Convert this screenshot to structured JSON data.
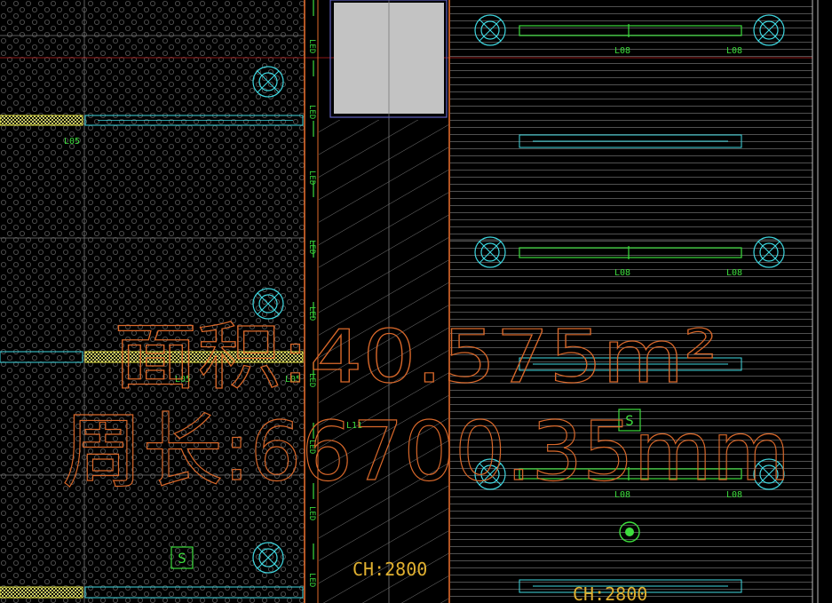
{
  "drawing": {
    "area_label": "面积:40.575m²",
    "perimeter_label": "周长:66700.35mm",
    "ceiling_height_label": "CH:2800",
    "ceiling_height_label_right": "CH:2800",
    "wall_strip_label": "LED",
    "light_tags": {
      "l05": "L05",
      "l08": "L08",
      "l11": "L11"
    },
    "switch_symbol": "S"
  },
  "colors": {
    "background": "#000000",
    "grid_line": "#7a7a7a",
    "wall": "#e06a2a",
    "dimension_text": "#d9682a",
    "light_cyan": "#3fd7e0",
    "light_green": "#3ddc3d",
    "light_yellow": "#e6e64a",
    "ceiling_height": "#e0b030",
    "hatch": "#9a9a9a",
    "board_gray": "#c3c3c3"
  }
}
